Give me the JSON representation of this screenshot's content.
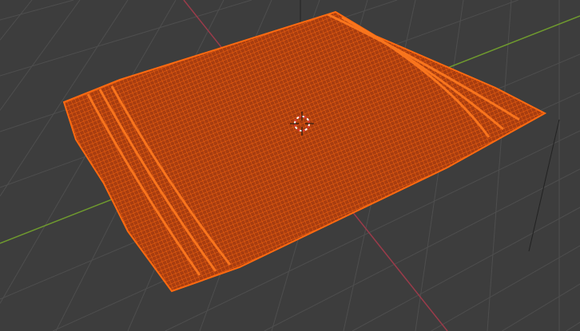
{
  "viewport": {
    "background": "#3d3d3d",
    "grid_color": "#4e4e4e",
    "x_axis_color": "#6f9a2e",
    "y_axis_color": "#9a3b4a",
    "mesh_fill": "#b5420f",
    "mesh_wire": "#ff6a10",
    "object": "cloth-mesh",
    "mode": "wireframe-selected"
  }
}
